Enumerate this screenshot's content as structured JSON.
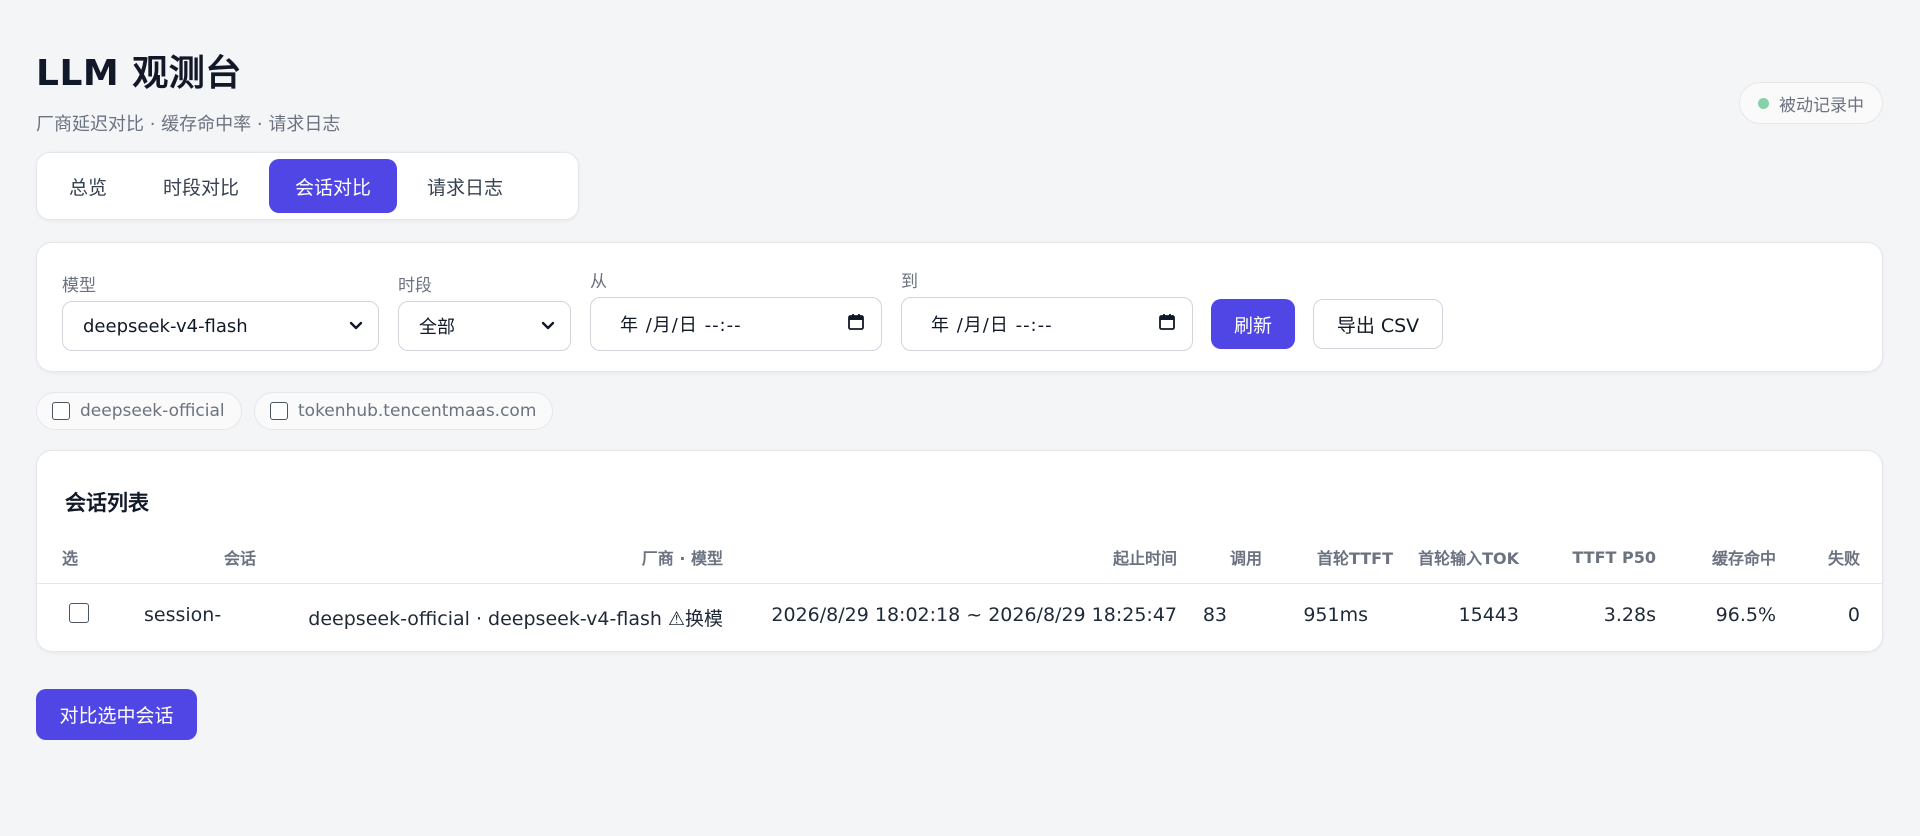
{
  "header": {
    "title": "LLM 观测台",
    "subtitle": "厂商延迟对比 · 缓存命中率 · 请求日志"
  },
  "status": {
    "label": "被动记录中",
    "color": "#86d2a8"
  },
  "tabs": [
    {
      "label": "总览",
      "active": false
    },
    {
      "label": "时段对比",
      "active": false
    },
    {
      "label": "会话对比",
      "active": true
    },
    {
      "label": "请求日志",
      "active": false
    }
  ],
  "filters": {
    "model_label": "模型",
    "model_value": "deepseek-v4-flash",
    "period_label": "时段",
    "period_value": "全部",
    "from_label": "从",
    "from_placeholder": "年 /月/日  --:--",
    "to_label": "到",
    "to_placeholder": "年 /月/日  --:--",
    "refresh_label": "刷新",
    "export_label": "导出 CSV"
  },
  "providers": [
    {
      "label": "deepseek-official",
      "checked": false
    },
    {
      "label": "tokenhub.tencentmaas.com",
      "checked": false
    }
  ],
  "sessions": {
    "title": "会话列表",
    "columns": {
      "select": "选",
      "session": "会话",
      "vendor_model": "厂商 · 模型",
      "time_range": "起止时间",
      "calls": "调用",
      "first_ttft": "首轮TTFT",
      "first_input_tok": "首轮输入TOK",
      "ttft_p50": "TTFT P50",
      "cache_hit": "缓存命中",
      "failures": "失败"
    },
    "rows": [
      {
        "session": "session-",
        "vendor_model": "deepseek-official · deepseek-v4-flash ⚠换模",
        "time_range": "2026/8/29 18:02:18 ~ 2026/8/29 18:25:47",
        "calls": "83",
        "first_ttft": "951ms",
        "first_input_tok": "15443",
        "ttft_p50": "3.28s",
        "cache_hit": "96.5%",
        "failures": "0"
      }
    ]
  },
  "actions": {
    "compare_label": "对比选中会话"
  },
  "colors": {
    "accent": "#4f46e5",
    "background": "#f4f5f7"
  }
}
